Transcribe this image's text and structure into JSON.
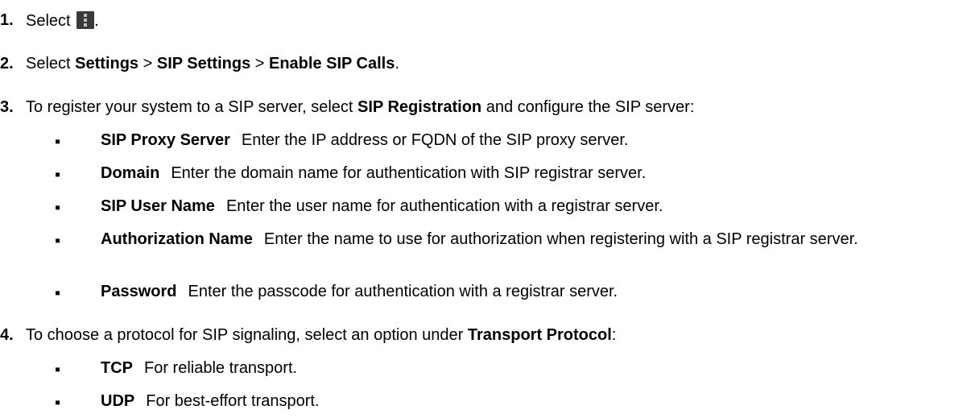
{
  "steps": [
    {
      "number": "1.",
      "text_before": "Select",
      "icon": "more-menu-icon",
      "text_after": "."
    },
    {
      "number": "2.",
      "parts": [
        "Select ",
        "Settings",
        " > ",
        "SIP Settings",
        " > ",
        "Enable SIP Calls",
        "."
      ]
    },
    {
      "number": "3.",
      "parts": [
        "To register your system to a SIP server, select ",
        "SIP Registration",
        " and configure the SIP server:"
      ],
      "items": [
        {
          "term": "SIP Proxy Server",
          "desc": "Enter the IP address or FQDN of the SIP proxy server."
        },
        {
          "term": "Domain",
          "desc": "Enter the domain name for authentication with SIP registrar server."
        },
        {
          "term": "SIP User Name",
          "desc": "Enter the user name for authentication with a registrar server."
        },
        {
          "term": "Authorization Name",
          "desc": "Enter the name to use for authorization when registering with a SIP registrar server."
        },
        {
          "term": "Password",
          "desc": "Enter the passcode for authentication with a registrar server."
        }
      ]
    },
    {
      "number": "4.",
      "parts": [
        "To choose a protocol for SIP signaling, select an option under ",
        "Transport Protocol",
        ":"
      ],
      "items": [
        {
          "term": "TCP",
          "desc": "For reliable transport."
        },
        {
          "term": "UDP",
          "desc": "For best-effort transport."
        }
      ]
    }
  ],
  "bullet_char": "▪"
}
